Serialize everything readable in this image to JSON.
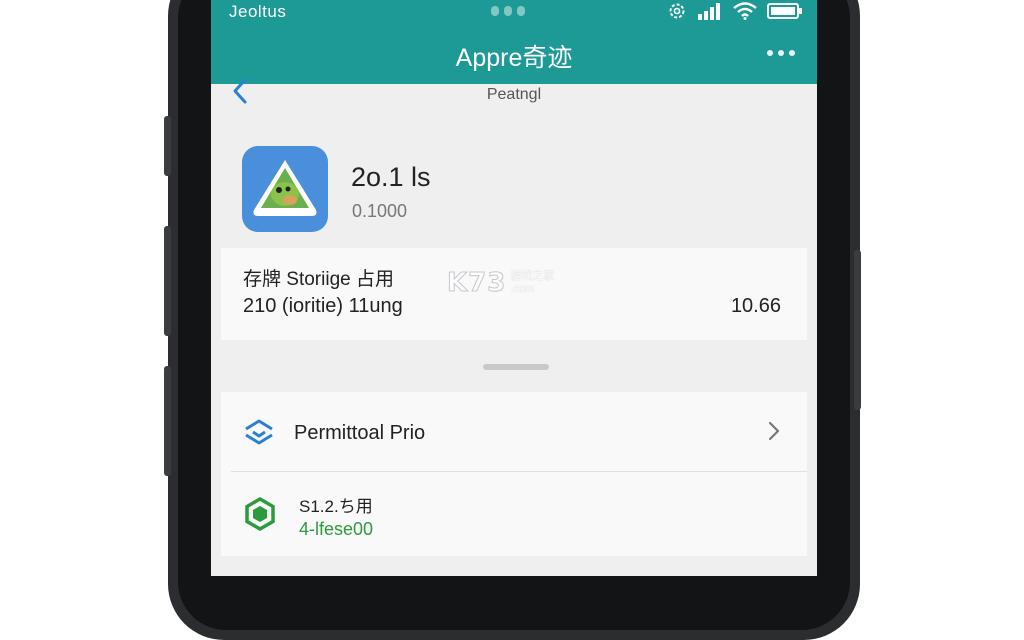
{
  "status_bar": {
    "carrier": "Jeoltus"
  },
  "header": {
    "title": "Appre奇迹",
    "subtitle": "Peatngl"
  },
  "app": {
    "name": "2o.1 ls",
    "version": "0.1000"
  },
  "storage": {
    "title": "存牌 Storiige 占用",
    "detail": "210 (ioritie) 11ung",
    "value": "10.66"
  },
  "watermark": {
    "logo": "K73",
    "line1": "游戏之家",
    "line2": ".com"
  },
  "list": {
    "items": [
      {
        "label": "Permittoal Prio",
        "icon": "shield-layers-icon"
      },
      {
        "title": "S1.2.ち用",
        "subtitle": "4-lfese00",
        "icon": "green-hexagon-icon"
      }
    ]
  },
  "colors": {
    "header": "#1e9a96",
    "accent_blue": "#2b7fd6",
    "accent_green": "#2e9a3e",
    "background": "#efefef"
  }
}
